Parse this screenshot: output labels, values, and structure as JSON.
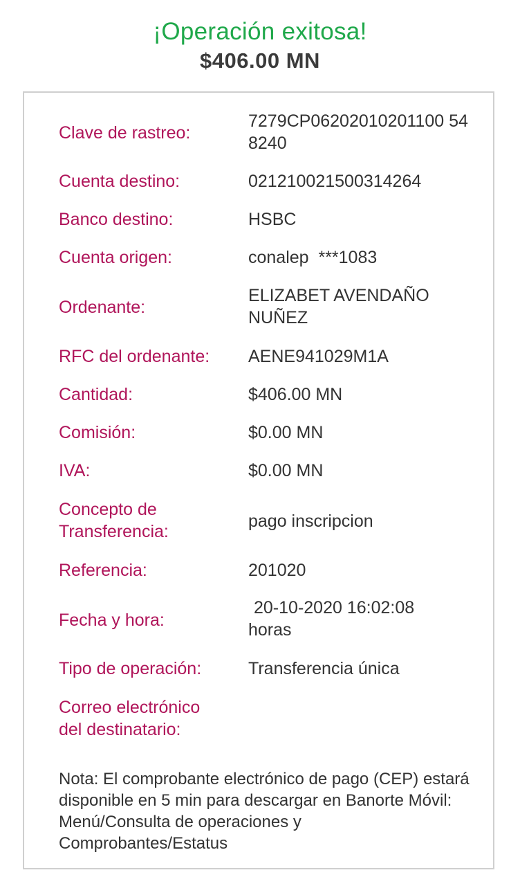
{
  "header": {
    "title": "¡Operación exitosa!",
    "amount": "$406.00 MN"
  },
  "details": [
    {
      "label": "Clave de rastreo:",
      "value": "7279CP06202010201100 548240"
    },
    {
      "label": "Cuenta destino:",
      "value": "021210021500314264"
    },
    {
      "label": "Banco destino:",
      "value": "HSBC"
    },
    {
      "label": "Cuenta origen:",
      "value": "conalep  ***1083"
    },
    {
      "label": "Ordenante:",
      "value": "ELIZABET AVENDAÑO NUÑEZ"
    },
    {
      "label": "RFC del ordenante:",
      "value": "AENE941029M1A"
    },
    {
      "label": "Cantidad:",
      "value": "$406.00 MN"
    },
    {
      "label": "Comisión:",
      "value": "$0.00 MN"
    },
    {
      "label": "IVA:",
      "value": "$0.00 MN"
    },
    {
      "label": "Concepto de Transferencia:",
      "value": "pago inscripcion"
    },
    {
      "label": "Referencia:",
      "value": "201020"
    },
    {
      "label": "Fecha y hora:",
      "value": "20-10-2020 16:02:08 horas"
    },
    {
      "label": "Tipo de operación:",
      "value": "Transferencia única"
    },
    {
      "label": "Correo electrónico del destinatario:",
      "value": ""
    }
  ],
  "note": "Nota: El comprobante electrónico de pago (CEP) estará disponible en 5 min para descargar en Banorte Móvil: Menú/Consulta de operaciones y Comprobantes/Estatus"
}
